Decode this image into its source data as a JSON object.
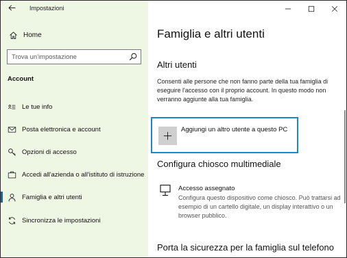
{
  "window": {
    "title": "Impostazioni",
    "controls": [
      "minimize",
      "maximize",
      "close"
    ]
  },
  "sidebar": {
    "home": "Home",
    "search_placeholder": "Trova un'impostazione",
    "section": "Account",
    "items": [
      {
        "label": "Le tue info",
        "icon": "contact-card-icon"
      },
      {
        "label": "Posta elettronica e account",
        "icon": "mail-icon"
      },
      {
        "label": "Opzioni di accesso",
        "icon": "key-icon"
      },
      {
        "label": "Accedi all'azienda o all'istituto di istruzione",
        "icon": "briefcase-icon"
      },
      {
        "label": "Famiglia e altri utenti",
        "icon": "person-icon",
        "selected": true
      },
      {
        "label": "Sincronizza le impostazioni",
        "icon": "sync-icon"
      }
    ]
  },
  "main": {
    "title": "Famiglia e altri utenti",
    "other_users": {
      "heading": "Altri utenti",
      "description": "Consenti alle persone che non fanno parte della tua famiglia di eseguire l'accesso con il proprio account. In questo modo non verranno aggiunte alla tua famiglia.",
      "add_button": "Aggiungi un altro utente a questo PC"
    },
    "kiosk": {
      "heading": "Configura chiosco multimediale",
      "item_title": "Accesso assegnato",
      "item_desc": "Configura questo dispositivo come chiosco. Può trattarsi ad esempio di un cartello digitale, un display interattivo o un browser pubblico."
    },
    "family_safety": {
      "heading": "Porta la sicurezza per la famiglia sul telefono"
    }
  },
  "colors": {
    "sidebar_bg": "#eef6e4",
    "accent": "#0067c0",
    "focus_border": "#1b87c7"
  }
}
